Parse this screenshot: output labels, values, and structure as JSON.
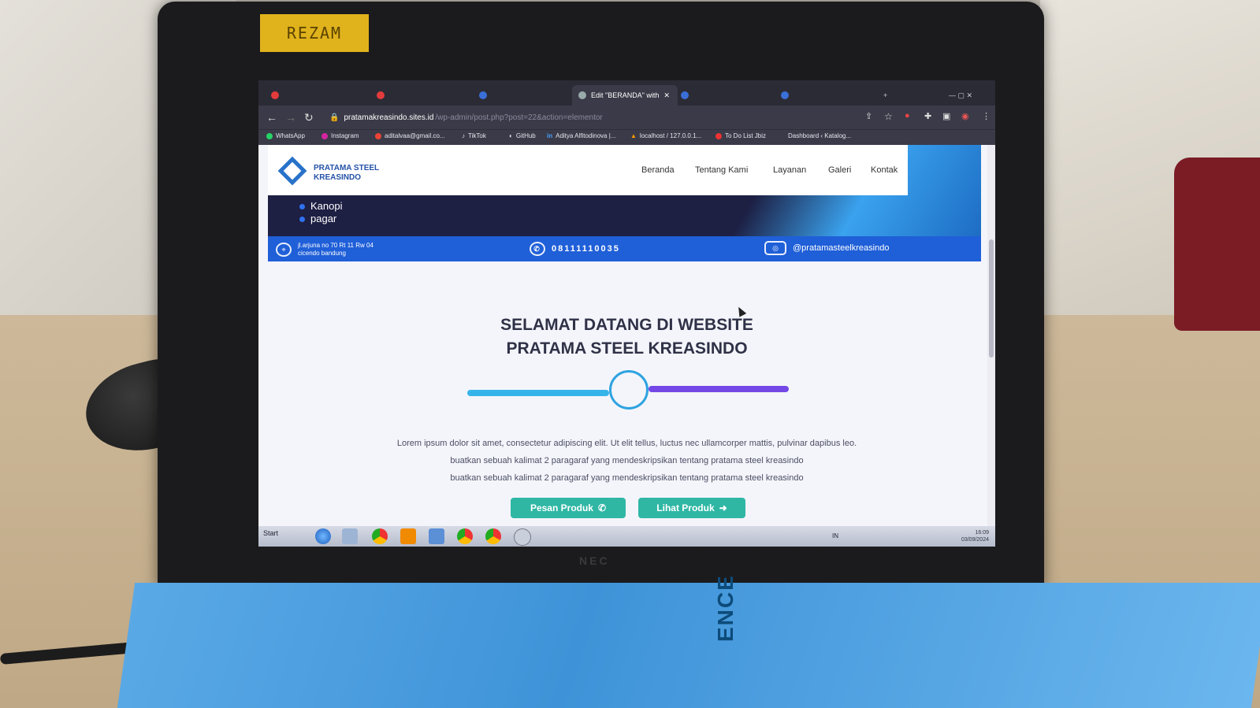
{
  "sticker": {
    "label": "REZAM"
  },
  "browser": {
    "tabs": [
      {
        "label": "",
        "color": "#e23b3b"
      },
      {
        "label": "",
        "color": "#e23b3b"
      },
      {
        "label": "",
        "color": "#3a6fd8"
      },
      {
        "label": "Edit \"BERANDA\" with",
        "color": "#9aa"
      },
      {
        "label": "",
        "color": "#3a6fd8"
      },
      {
        "label": "",
        "color": "#3a6fd8"
      }
    ],
    "url_host": "pratamakreasindo.sites.id",
    "url_path": "/wp-admin/post.php?post=22&action=elementor",
    "bookmarks": [
      "WhatsApp",
      "Instagram",
      "aditalvaa@gmail.co...",
      "TikTok",
      "GitHub",
      "Aditya Alfitodinova |...",
      "localhost / 127.0.0.1...",
      "To Do List Jbiz",
      "Dashboard ‹ Katalog..."
    ]
  },
  "site": {
    "logo_line1": "PRATAMA STEEL",
    "logo_line2": "KREASINDO",
    "menu": [
      "Beranda",
      "Tentang Kami",
      "Layanan",
      "Galeri",
      "Kontak"
    ],
    "services": [
      "Kanopi",
      "pagar"
    ],
    "address_line1": "jl.arjuna no 70 Rt 11 Rw 04",
    "address_line2": "cicendo bandung",
    "phone": "08111110035",
    "instagram": "@pratamasteelkreasindo",
    "welcome_line1": "SELAMAT DATANG DI WEBSITE",
    "welcome_line2": "PRATAMA STEEL KREASINDO",
    "para_line1": "Lorem ipsum dolor sit amet, consectetur adipiscing elit. Ut elit tellus, luctus nec ullamcorper mattis, pulvinar dapibus leo.",
    "para_line2": "buatkan sebuah kalimat 2 paragaraf yang mendeskripsikan tentang pratama steel kreasindo",
    "para_line3": "buatkan sebuah kalimat 2 paragaraf yang mendeskripsikan tentang pratama steel kreasindo",
    "btn_order": "Pesan Produk",
    "btn_view": "Lihat Produk"
  },
  "taskbar": {
    "start": "Start",
    "lang": "IN",
    "time": "16:09",
    "date": "03/09/2024"
  },
  "book": {
    "text": "ENCE"
  },
  "colors": {
    "accent": "#1f5fd8",
    "hero_dark": "#1d1f43",
    "button": "#2fb7a4",
    "slider_left": "#36b4ea",
    "slider_right": "#7448e6"
  }
}
